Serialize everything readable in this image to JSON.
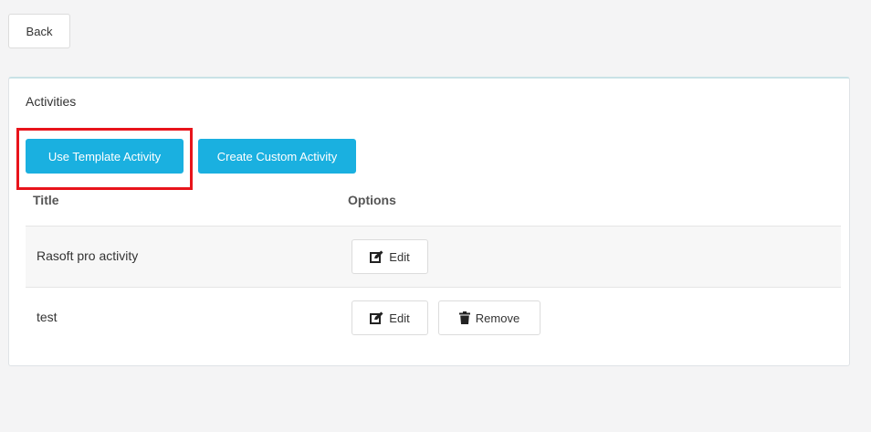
{
  "toolbar": {
    "back_label": "Back"
  },
  "panel": {
    "title": "Activities",
    "use_template_label": "Use Template Activity",
    "create_custom_label": "Create Custom Activity"
  },
  "table": {
    "columns": [
      "Title",
      "Options"
    ],
    "rows": [
      {
        "title": "Rasoft pro activity",
        "actions": [
          {
            "label": "Edit",
            "icon": "edit-icon"
          }
        ]
      },
      {
        "title": "test",
        "actions": [
          {
            "label": "Edit",
            "icon": "edit-icon"
          },
          {
            "label": "Remove",
            "icon": "trash-icon"
          }
        ]
      }
    ]
  },
  "colors": {
    "accent": "#1ab0e0",
    "highlight": "#e8141b"
  }
}
